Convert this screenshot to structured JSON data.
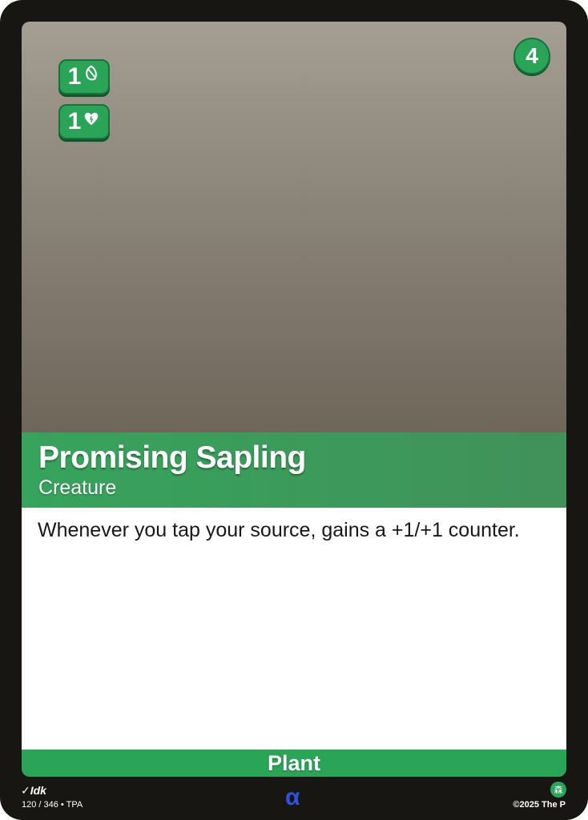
{
  "card": {
    "name": "Promising Sapling",
    "card_type": "Creature",
    "cost": "4",
    "rules_text": "Whenever you tap your source, gains a +1/+1 counter.",
    "subtype": "Plant",
    "stats": [
      {
        "value": "1",
        "icon": "attack-leaf-icon"
      },
      {
        "value": "1",
        "icon": "health-heart-icon"
      }
    ],
    "colors": {
      "primary_green": "#2aa558",
      "frame": "#181612",
      "rarity_blue": "#2f52e0"
    }
  },
  "footer": {
    "artist": "Idk",
    "collector_info": "120 / 346 • TPA",
    "rarity_symbol": "α",
    "set_symbol": "森",
    "copyright": "©2025 The P"
  }
}
